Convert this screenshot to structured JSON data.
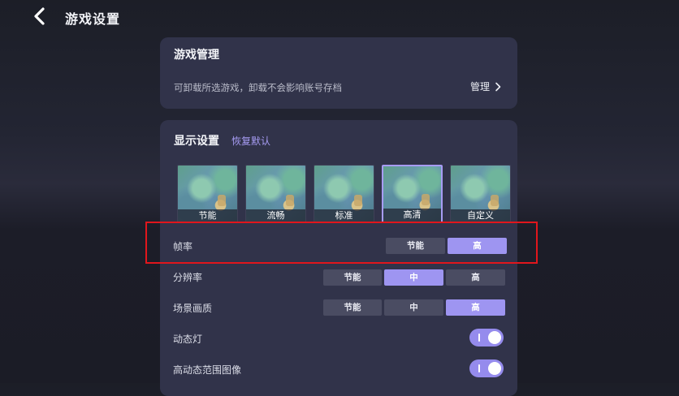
{
  "header": {
    "title": "游戏设置",
    "back_icon": "chevron-left-icon"
  },
  "manage_card": {
    "title": "游戏管理",
    "description": "可卸载所选游戏，卸载不会影响账号存档",
    "link_label": "管理"
  },
  "display_card": {
    "title": "显示设置",
    "restore_label": "恢复默认",
    "presets": [
      {
        "label": "节能",
        "selected": false
      },
      {
        "label": "流畅",
        "selected": false
      },
      {
        "label": "标准",
        "selected": false
      },
      {
        "label": "高清",
        "selected": true
      },
      {
        "label": "自定义",
        "selected": false
      }
    ],
    "frame_rate": {
      "label": "帧率",
      "options": [
        "节能",
        "高"
      ],
      "selected": "高"
    },
    "resolution": {
      "label": "分辨率",
      "options": [
        "节能",
        "中",
        "高"
      ],
      "selected": "中"
    },
    "scene_quality": {
      "label": "场景画质",
      "options": [
        "节能",
        "中",
        "高"
      ],
      "selected": "高"
    },
    "dynamic_light": {
      "label": "动态灯",
      "enabled": true
    },
    "hdr": {
      "label": "高动态范围图像",
      "enabled": true
    }
  },
  "colors": {
    "accent": "#9e95f1",
    "card_bg": "#31334a",
    "highlight": "#e1161c"
  }
}
